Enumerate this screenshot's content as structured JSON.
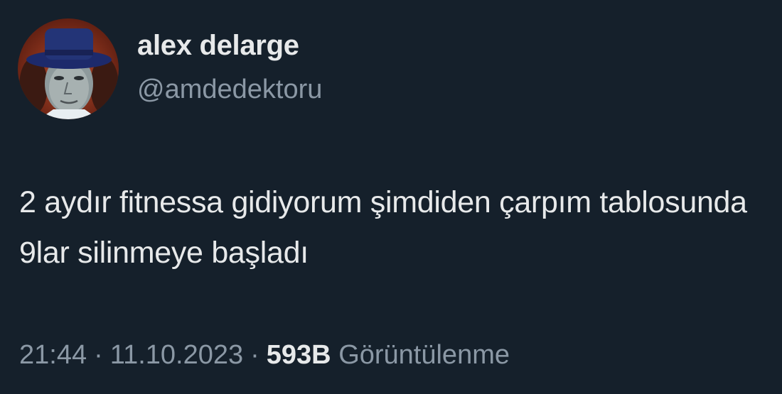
{
  "tweet": {
    "author": {
      "display_name": "alex delarge",
      "handle": "@amdedektoru"
    },
    "text": "2 aydır fitnessa gidiyorum şimdiden çarpım tablosunda 9lar silinmeye başladı",
    "meta": {
      "time": "21:44",
      "separator": "·",
      "date": "11.10.2023",
      "views_count": "593B",
      "views_label": "Görüntülenme"
    }
  },
  "colors": {
    "background": "#15202b",
    "primary_text": "#e7e9ea",
    "secondary_text": "#8b98a5"
  },
  "icons": {
    "avatar": "profile-picture"
  }
}
